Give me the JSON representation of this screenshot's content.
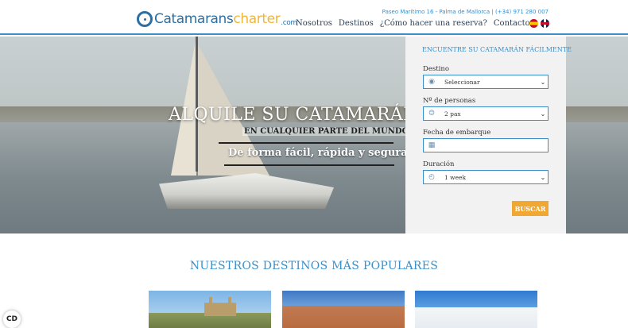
{
  "header": {
    "logo": {
      "part1": "Catamarans",
      "part2": "charter",
      "part3": ".com"
    },
    "contact_line": "Paseo Marítimo 16 - Palma de Mallorca | (+34) 971 280 007",
    "nav": [
      "Nosotros",
      "Destinos",
      "¿Cómo hacer una reserva?",
      "Contacto"
    ],
    "languages": [
      "es",
      "en"
    ]
  },
  "hero": {
    "title": "ALQUILE SU CATAMARÁN",
    "subtitle": "EN CUALQUIER PARTE DEL MUNDO",
    "tagline": "De forma fácil, rápida y segura"
  },
  "search": {
    "title": "ENCUENTRE SU CATAMARÁN FÁCILMENTE",
    "destino": {
      "label": "Destino",
      "value": "Seleccionar",
      "icon": "location-pin-icon"
    },
    "personas": {
      "label": "Nº de personas",
      "value": "2 pax",
      "icon": "people-icon"
    },
    "fecha": {
      "label": "Fecha de embarque",
      "value": "",
      "icon": "calendar-icon"
    },
    "duracion": {
      "label": "Duración",
      "value": "1 week",
      "icon": "clock-icon"
    },
    "button": "BUSCAR"
  },
  "popular": {
    "title": "NUESTROS DESTINOS MÁS POPULARES"
  },
  "consent_button": "CD",
  "colors": {
    "accent": "#3a8fc9",
    "cta": "#f0a832",
    "logo_blue": "#2d6fa3",
    "logo_yellow": "#f0b63a"
  }
}
